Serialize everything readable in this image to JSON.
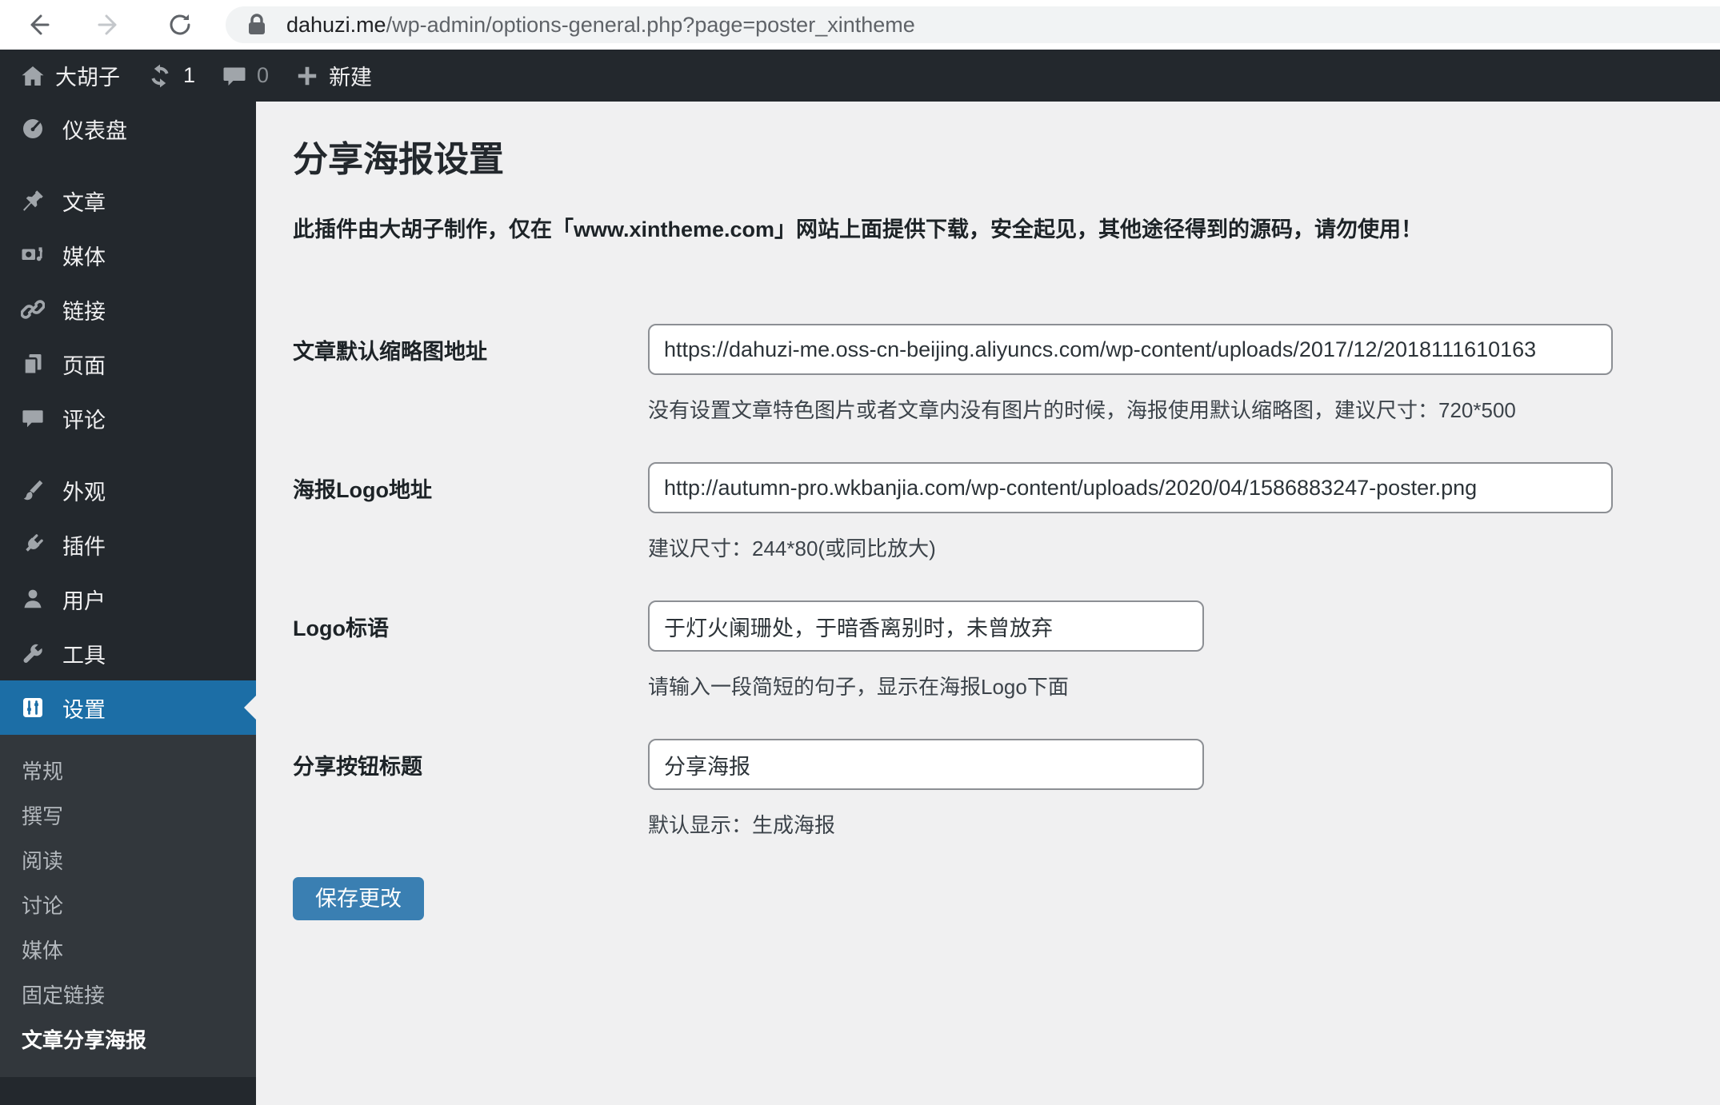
{
  "browser": {
    "url_host": "dahuzi.me",
    "url_path": "/wp-admin/options-general.php?page=poster_xintheme"
  },
  "admin_bar": {
    "site_name": "大胡子",
    "update_count": "1",
    "comment_count": "0",
    "new_label": "新建"
  },
  "sidebar": {
    "items": [
      {
        "label": "仪表盘"
      },
      {
        "label": "文章"
      },
      {
        "label": "媒体"
      },
      {
        "label": "链接"
      },
      {
        "label": "页面"
      },
      {
        "label": "评论"
      },
      {
        "label": "外观"
      },
      {
        "label": "插件"
      },
      {
        "label": "用户"
      },
      {
        "label": "工具"
      },
      {
        "label": "设置"
      }
    ],
    "submenu": [
      "常规",
      "撰写",
      "阅读",
      "讨论",
      "媒体",
      "固定链接",
      "文章分享海报"
    ]
  },
  "page": {
    "title": "分享海报设置",
    "description": "此插件由大胡子制作，仅在「www.xintheme.com」网站上面提供下载，安全起见，其他途径得到的源码，请勿使用！"
  },
  "form": {
    "rows": [
      {
        "label": "文章默认缩略图地址",
        "value": "https://dahuzi-me.oss-cn-beijing.aliyuncs.com/wp-content/uploads/2017/12/2018111610163",
        "helper": "没有设置文章特色图片或者文章内没有图片的时候，海报使用默认缩略图，建议尺寸：720*500"
      },
      {
        "label": "海报Logo地址",
        "value": "http://autumn-pro.wkbanjia.com/wp-content/uploads/2020/04/1586883247-poster.png",
        "helper": "建议尺寸：244*80(或同比放大)"
      },
      {
        "label": "Logo标语",
        "value": "于灯火阑珊处，于暗香离别时，未曾放弃",
        "helper": "请输入一段简短的句子，显示在海报Logo下面"
      },
      {
        "label": "分享按钮标题",
        "value": "分享海报",
        "helper": "默认显示：生成海报"
      }
    ],
    "save_label": "保存更改"
  },
  "colors": {
    "menu_highlight": "#1c6ea6",
    "button_primary": "#3a7fb2",
    "admin_dark": "#23282d",
    "submenu_dark": "#32373c",
    "content_bg": "#f0f0f1"
  }
}
